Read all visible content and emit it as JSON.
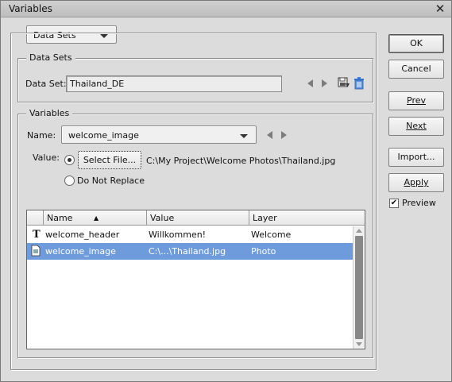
{
  "window": {
    "title": "Variables",
    "close_glyph": "✕"
  },
  "mode_dropdown": {
    "value": "Data Sets"
  },
  "data_sets_group": {
    "legend": "Data Sets",
    "label": "Data Set:",
    "value": "Thailand_DE",
    "icons": [
      "save-data-set-icon",
      "trash-icon"
    ]
  },
  "variables_group": {
    "legend": "Variables",
    "name_label": "Name:",
    "name_value": "welcome_image",
    "value_label": "Value:",
    "select_file_label": "Select File...",
    "file_path": "C:\\My Project\\Welcome Photos\\Thailand.jpg",
    "do_not_replace_label": "Do Not Replace",
    "selected_option": "select_file"
  },
  "table": {
    "columns": [
      "Name",
      "Value",
      "Layer"
    ],
    "sort_indicator": "▲",
    "rows": [
      {
        "icon": "text-layer-icon",
        "icon_glyph": "T",
        "name": "welcome_header",
        "value": "Willkommen!",
        "layer": "Welcome",
        "selected": false
      },
      {
        "icon": "image-layer-icon",
        "icon_glyph": "",
        "name": "welcome_image",
        "value": "C:\\...\\Thailand.jpg",
        "layer": "Photo",
        "selected": true
      }
    ]
  },
  "buttons": {
    "ok": "OK",
    "cancel": "Cancel",
    "prev": "Prev",
    "next": "Next",
    "import": "Import...",
    "apply": "Apply"
  },
  "preview": {
    "label": "Preview",
    "checked": true
  },
  "colors": {
    "selection": "#6e9bdc",
    "background": "#dcdcdc"
  }
}
